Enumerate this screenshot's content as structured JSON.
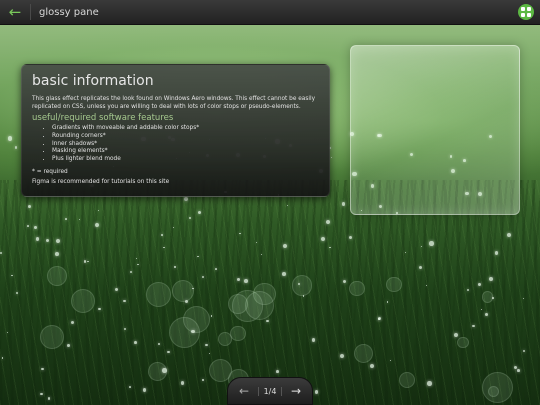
{
  "topbar": {
    "back_icon": "back-arrow-icon",
    "title": "glossy pane",
    "menu_icon": "grid-menu-icon",
    "accent": "#5cb843"
  },
  "panel": {
    "heading": "basic information",
    "description": "This glass effect replicates the look found on Windows Aero windows. This effect cannot be easily replicated on CSS, unless you are willing to deal with lots of color stops or pseudo-elements.",
    "features_heading": "useful/required software features",
    "features": [
      "Gradients with moveable and addable color stops*",
      "Rounding corners*",
      "Inner shadows*",
      "Masking elements*",
      "Plus lighter blend mode"
    ],
    "note": "* = required",
    "footer": "Figma is recommended for tutorials on this site",
    "heading_color": "#a6c98f"
  },
  "pager": {
    "prev_icon": "arrow-left-icon",
    "page_label": "1/4",
    "next_icon": "arrow-right-icon"
  }
}
